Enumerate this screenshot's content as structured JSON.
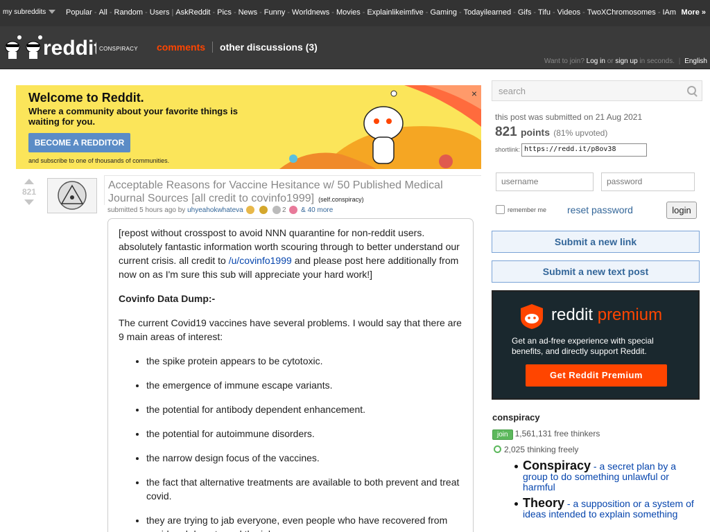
{
  "topbar": {
    "my_subreddits": "my subreddits",
    "links": [
      "Popular",
      "All",
      "Random",
      "Users",
      "AskReddit",
      "Pics",
      "News",
      "Funny",
      "Worldnews",
      "Movies",
      "Explainlikeimfive",
      "Gaming",
      "Todayilearned",
      "Gifs",
      "Tifu",
      "Videos",
      "TwoXChromosomes",
      "IAm"
    ],
    "more": "More »"
  },
  "header": {
    "subreddit": "conspiracy",
    "tab_comments": "comments",
    "tab_other": "other discussions (3)",
    "want_to_join": "Want to join?",
    "login_link": "Log in",
    "or": "or",
    "signup_link": "sign up",
    "in_seconds": "in seconds.",
    "language": "English"
  },
  "banner": {
    "title": "Welcome to Reddit.",
    "subtitle": "Where a community about your favorite things is waiting for you.",
    "button": "BECOME A REDDITOR",
    "footer": "and subscribe to one of thousands of communities.",
    "close": "×"
  },
  "post": {
    "score": "821",
    "title": "Acceptable Reasons for Vaccine Hesitance w/ 50 Published Medical Journal Sources [all credit to covinfo1999]",
    "domain": "(self.conspiracy)",
    "submitted": "submitted 5 hours ago by",
    "author": "uhyeahokwhateva",
    "award_count": "2",
    "more_awards": "& 40 more",
    "body_intro_1": "[repost without crosspost to avoid NNN quarantine for non-reddit users. absolutely fantastic information worth scouring through to better understand our current crisis. all credit to",
    "body_user_link": "/u/covinfo1999",
    "body_intro_2": "and please post here additionally from now on as I'm sure this sub will appreciate your hard work!]",
    "heading": "Covinfo Data Dump:-",
    "para2": "The current Covid19 vaccines have several problems. I would say that there are 9 main areas of interest:",
    "bullets": [
      "the spike protein appears to be cytotoxic.",
      "the emergence of immune escape variants.",
      "the potential for antibody dependent enhancement.",
      "the potential for autoimmune disorders.",
      "the narrow design focus of the vaccines.",
      "the fact that alternative treatments are available to both prevent and treat covid.",
      "they are trying to jab everyone, even people who have recovered from covid and do not need the jab."
    ]
  },
  "sidebar": {
    "search_placeholder": "search",
    "submitted_text": "this post was submitted on 21 Aug 2021",
    "points": "821",
    "points_label": "points",
    "upvoted": "(81% upvoted)",
    "shortlink_label": "shortlink:",
    "shortlink_value": "https://redd.it/p8ov38",
    "username_placeholder": "username",
    "password_placeholder": "password",
    "remember_me": "remember me",
    "reset_password": "reset password",
    "login_button": "login",
    "submit_link": "Submit a new link",
    "submit_text": "Submit a new text post",
    "premium_reddit": "reddit",
    "premium_word": "premium",
    "premium_desc": "Get an ad-free experience with special benefits, and directly support Reddit.",
    "premium_button": "Get Reddit Premium",
    "sr_name": "conspiracy",
    "join": "join",
    "subscribers": "1,561,131 free thinkers",
    "online": "2,025 thinking freely",
    "def1_term": "Conspiracy",
    "def1_text": " - a secret plan by a group to do something unlawful or harmful",
    "def2_term": "Theory",
    "def2_text": " - a supposition or a system of ideas intended to explain something"
  },
  "colors": {
    "accent": "#ff4500",
    "link": "#0645ad",
    "header_bg": "#3a3a3a",
    "banner_bg": "#fbe55a",
    "premium_bg": "#1a282e"
  }
}
